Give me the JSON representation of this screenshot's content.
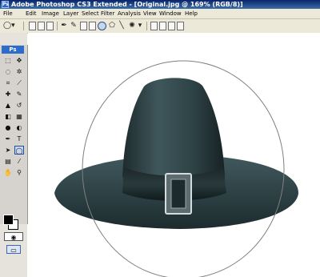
{
  "window": {
    "app_icon_label": "Ps",
    "title": "Adobe Photoshop CS3 Extended - [Original.jpg @ 169% (RGB/8)]"
  },
  "menu": [
    "File",
    "Edit",
    "Image",
    "Layer",
    "Select",
    "Filter",
    "Analysis",
    "View",
    "Window",
    "Help"
  ],
  "toolbox": {
    "badge": "Ps",
    "tools": [
      {
        "name": "marquee-tool",
        "glyph": "⬚"
      },
      {
        "name": "move-tool",
        "glyph": "✥"
      },
      {
        "name": "lasso-tool",
        "glyph": "◌"
      },
      {
        "name": "magic-wand-tool",
        "glyph": "✲"
      },
      {
        "name": "crop-tool",
        "glyph": "⌗"
      },
      {
        "name": "eyedropper-tool",
        "glyph": "⟋"
      },
      {
        "name": "healing-brush-tool",
        "glyph": "✚"
      },
      {
        "name": "brush-tool",
        "glyph": "✎"
      },
      {
        "name": "clone-stamp-tool",
        "glyph": "▲"
      },
      {
        "name": "history-brush-tool",
        "glyph": "↺"
      },
      {
        "name": "eraser-tool",
        "glyph": "◧"
      },
      {
        "name": "gradient-tool",
        "glyph": "▦"
      },
      {
        "name": "blur-tool",
        "glyph": "●"
      },
      {
        "name": "dodge-tool",
        "glyph": "◐"
      },
      {
        "name": "pen-tool",
        "glyph": "✒"
      },
      {
        "name": "type-tool",
        "glyph": "T"
      },
      {
        "name": "path-selection-tool",
        "glyph": "➤"
      },
      {
        "name": "ellipse-tool",
        "glyph": "◯"
      },
      {
        "name": "notes-tool",
        "glyph": "▤"
      },
      {
        "name": "eyedropper2-tool",
        "glyph": "⁄"
      },
      {
        "name": "hand-tool",
        "glyph": "✋"
      },
      {
        "name": "zoom-tool",
        "glyph": "⚲"
      }
    ]
  }
}
